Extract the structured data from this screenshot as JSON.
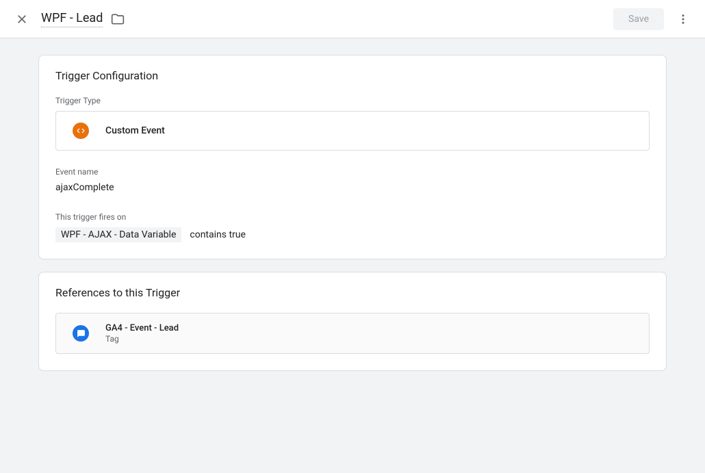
{
  "header": {
    "title": "WPF - Lead",
    "save_label": "Save"
  },
  "triggerConfig": {
    "title": "Trigger Configuration",
    "triggerTypeLabel": "Trigger Type",
    "triggerTypeName": "Custom Event",
    "eventNameLabel": "Event name",
    "eventNameValue": "ajaxComplete",
    "firesOnLabel": "This trigger fires on",
    "condition": {
      "variable": "WPF - AJAX - Data Variable",
      "rest": "contains true"
    }
  },
  "references": {
    "title": "References to this Trigger",
    "items": [
      {
        "name": "GA4 - Event - Lead",
        "type": "Tag"
      }
    ]
  }
}
